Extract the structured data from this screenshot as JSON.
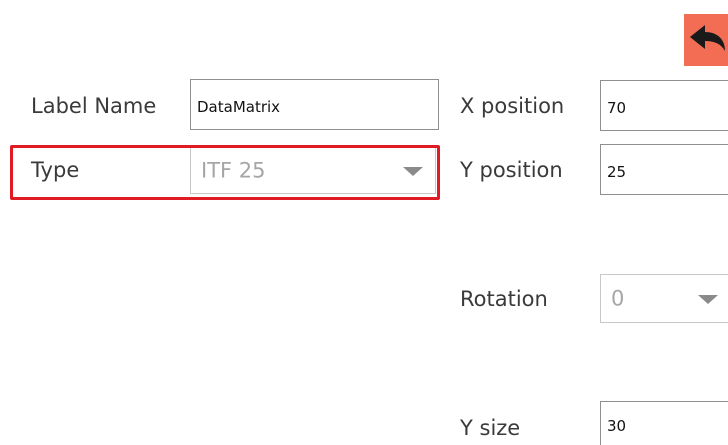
{
  "toolbar": {
    "back_icon": "undo-arrow-icon",
    "accent_color": "#f26d54"
  },
  "form": {
    "label_name": {
      "label": "Label Name",
      "value": "DataMatrix"
    },
    "type": {
      "label": "Type",
      "value": "ITF 25"
    },
    "x_position": {
      "label": "X position",
      "value": "70"
    },
    "y_position": {
      "label": "Y position",
      "value": "25"
    },
    "rotation": {
      "label": "Rotation",
      "value": "0"
    },
    "y_size": {
      "label": "Y size",
      "value": "30"
    }
  },
  "highlight": {
    "target": "type",
    "color": "#e01b24"
  }
}
